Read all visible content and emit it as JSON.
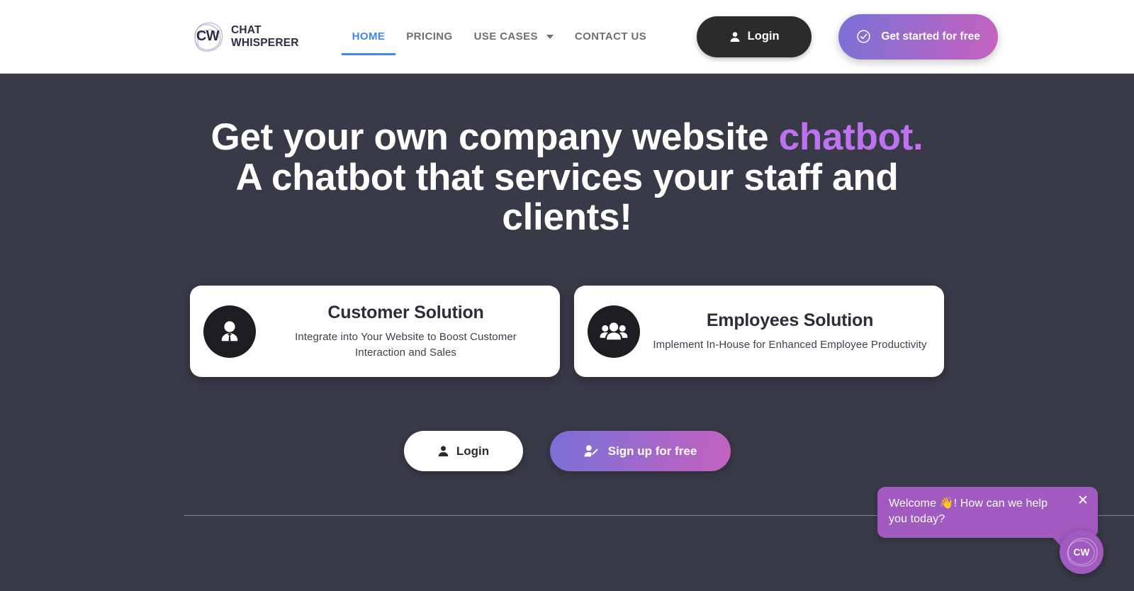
{
  "header": {
    "logo": {
      "mark_text": "CW",
      "name_line1": "CHAT",
      "name_line2": "WHISPERER"
    },
    "nav": [
      {
        "label": "HOME",
        "active": true,
        "has_caret": false
      },
      {
        "label": "PRICING",
        "active": false,
        "has_caret": false
      },
      {
        "label": "USE CASES",
        "active": false,
        "has_caret": true
      },
      {
        "label": "CONTACT US",
        "active": false,
        "has_caret": false
      }
    ],
    "login_label": "Login",
    "login_icon": "user-icon",
    "get_started_label": "Get started for free",
    "get_started_icon": "check-circle-icon",
    "get_started_gradient_from": "#7b6fd4",
    "get_started_gradient_to": "#c463c0"
  },
  "hero": {
    "line1_plain": "Get your own company website ",
    "line1_accent": "chatbot.",
    "line2": "A chatbot that services your staff and clients!",
    "accent_color": "#bf72f0"
  },
  "cards": [
    {
      "icon": "business-person-icon",
      "title": "Customer Solution",
      "description": "Integrate into Your Website to Boost Customer Interaction and Sales"
    },
    {
      "icon": "group-people-icon",
      "title": "Employees Solution",
      "description": "Implement In-House for Enhanced Employee Productivity"
    }
  ],
  "cta": {
    "login_label": "Login",
    "login_icon": "user-icon",
    "signup_label": "Sign up for free",
    "signup_icon": "user-plus-icon"
  },
  "chat_widget": {
    "message": "Welcome 👋! How can we help you today?",
    "close_icon": "close-icon",
    "fab_label": "CW",
    "bubble_color": "#a05ac0"
  },
  "theme": {
    "page_background": "#393a47",
    "header_background": "#ffffff",
    "nav_active_color": "#4285f4",
    "nav_inactive_color": "#6c6f75",
    "card_background": "#ffffff",
    "icon_circle_color": "#1e1e22"
  }
}
